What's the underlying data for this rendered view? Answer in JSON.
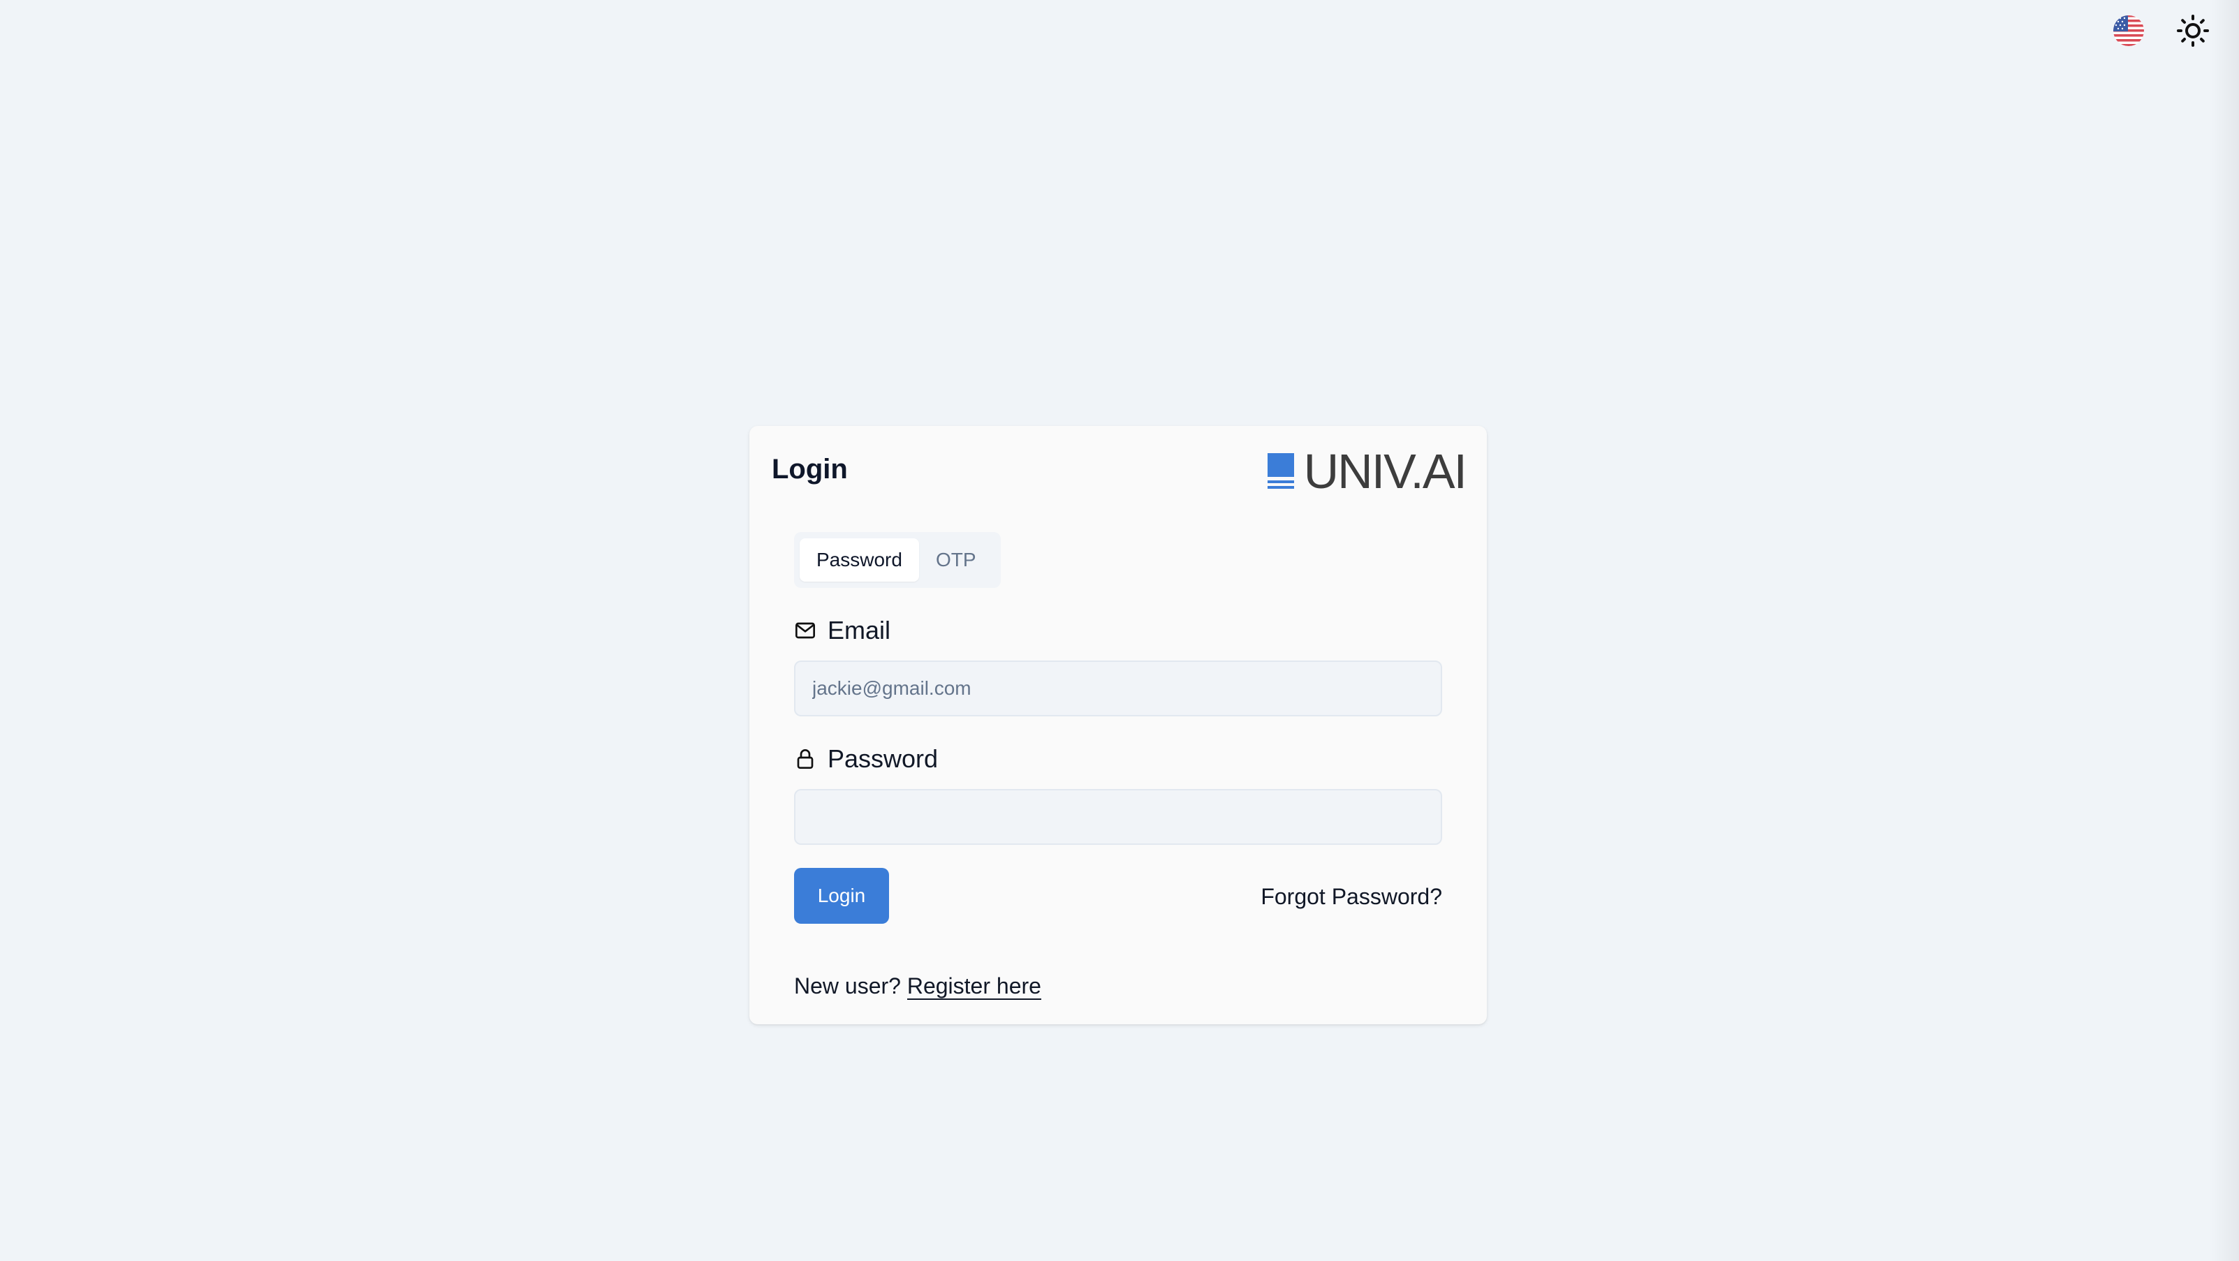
{
  "header": {
    "language_icon": "us-flag-icon",
    "theme_icon": "sun-icon"
  },
  "card": {
    "title": "Login",
    "brand": {
      "text": "UNIV.AI",
      "accent_color": "#3b7dd8"
    },
    "tabs": [
      {
        "label": "Password",
        "active": true
      },
      {
        "label": "OTP",
        "active": false
      }
    ],
    "email": {
      "label": "Email",
      "icon": "mail-icon",
      "placeholder": "jackie@gmail.com",
      "value": ""
    },
    "password": {
      "label": "Password",
      "icon": "lock-icon",
      "placeholder": "",
      "value": ""
    },
    "login_button": "Login",
    "forgot_password": "Forgot Password?",
    "register": {
      "prompt": "New user?",
      "link": "Register here"
    }
  },
  "colors": {
    "background": "#f0f4f8",
    "primary": "#3b7dd8"
  }
}
